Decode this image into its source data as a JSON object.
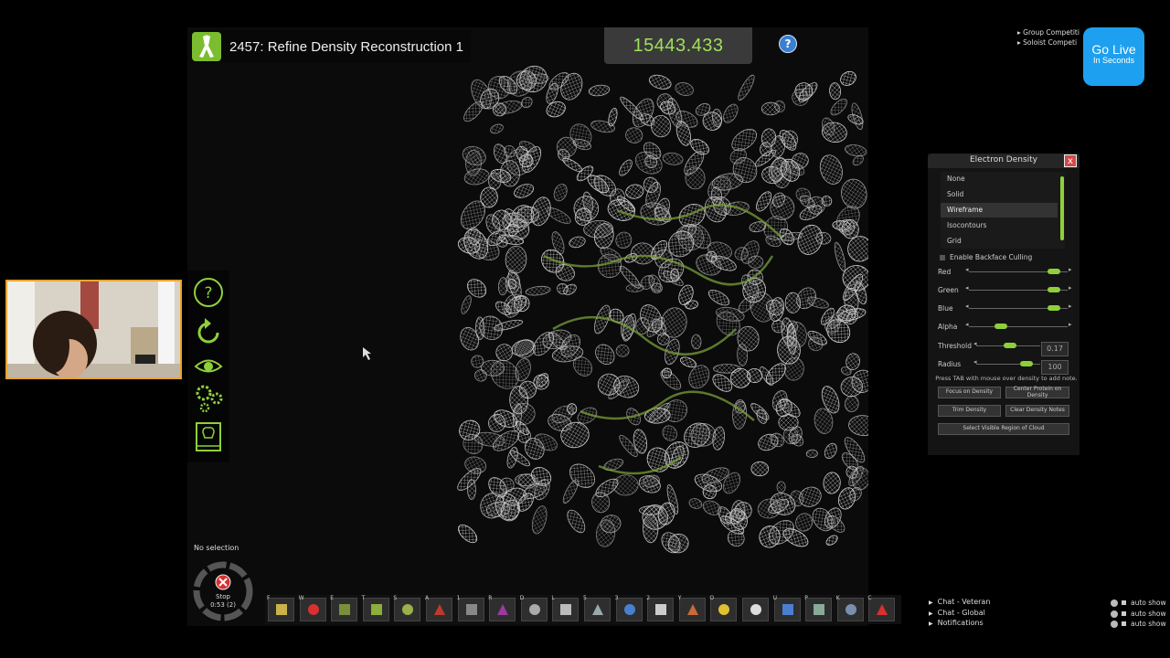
{
  "puzzle": {
    "title": "2457: Refine Density Reconstruction 1"
  },
  "score": "15443.433",
  "help_label": "?",
  "density_panel": {
    "title": "Electron Density",
    "close": "x",
    "render_modes": [
      "None",
      "Solid",
      "Wireframe",
      "Isocontours",
      "Grid"
    ],
    "selected_mode": "Wireframe",
    "backface_culling_label": "Enable Backface Culling",
    "sliders": [
      {
        "label": "Red",
        "value": 0.92
      },
      {
        "label": "Green",
        "value": 0.92
      },
      {
        "label": "Blue",
        "value": 0.92
      },
      {
        "label": "Alpha",
        "value": 0.3
      },
      {
        "label": "Threshold",
        "value": 0.53
      },
      {
        "label": "Radius",
        "value": 0.85
      }
    ],
    "threshold_value": "0.17",
    "radius_value": "100",
    "note": "Press TAB with mouse over density to add note.",
    "buttons": {
      "focus": "Focus on Density",
      "center": "Center Protein on Density",
      "trim": "Trim Density",
      "clear": "Clear Density Notes",
      "select": "Select Visible Region of Cloud"
    }
  },
  "competitions": [
    "Group Competiti",
    "Soloist Competi"
  ],
  "go_live": {
    "line1": "Go Live",
    "line2": "In Seconds"
  },
  "selection": {
    "status": "No selection",
    "stop_label": "Stop",
    "timer": "0:53 (2)"
  },
  "toolbar_keys": [
    "F",
    "W",
    "E",
    "T",
    "S",
    "A",
    "1",
    "R",
    "D",
    "L",
    "5",
    "3",
    "2",
    "Y",
    "O",
    "",
    "U",
    "P",
    "K",
    "C"
  ],
  "chat": [
    "Chat - Veteran",
    "Chat - Global",
    "Notifications"
  ],
  "auto_show": [
    "auto show",
    "auto show",
    "auto show"
  ],
  "colors": {
    "accent_green": "#8fd03a",
    "score_green": "#9fe05a",
    "webcam_border": "#e8a531",
    "go_live_blue": "#1ea0f0"
  }
}
